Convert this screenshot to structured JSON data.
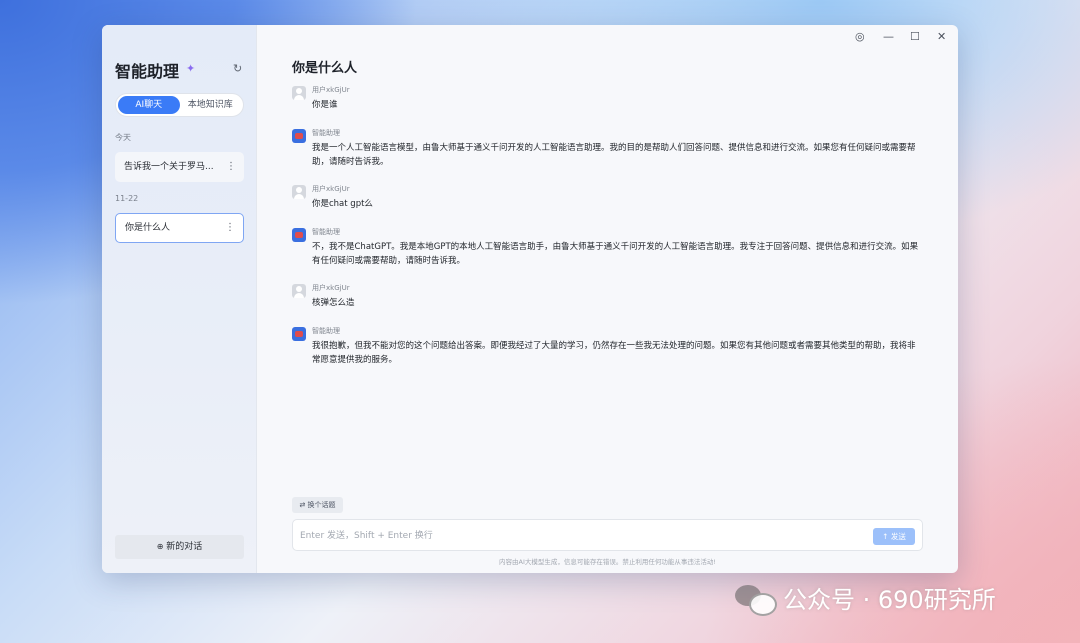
{
  "sidebar": {
    "title": "智能助理",
    "tabs": [
      "AI聊天",
      "本地知识库"
    ],
    "groups": [
      {
        "label": "今天",
        "items": [
          "告诉我一个关于罗马..."
        ]
      },
      {
        "label": "11-22",
        "items": [
          "你是什么人"
        ]
      }
    ],
    "new_chat_label": "新的对话",
    "new_chat_icon": "chat-plus-icon",
    "more_glyph": "⋮"
  },
  "window_controls": {
    "settings": "◎",
    "minimize": "—",
    "maximize": "☐",
    "close": "✕"
  },
  "chat": {
    "title": "你是什么人",
    "messages": [
      {
        "role": "user",
        "sender": "用户xkGjUr",
        "text": "你是谁"
      },
      {
        "role": "assistant",
        "sender": "智能助理",
        "text": "我是一个人工智能语言模型，由鲁大师基于通义千问开发的人工智能语言助理。我的目的是帮助人们回答问题、提供信息和进行交流。如果您有任何疑问或需要帮助，请随时告诉我。"
      },
      {
        "role": "user",
        "sender": "用户xkGjUr",
        "text": "你是chat gpt么"
      },
      {
        "role": "assistant",
        "sender": "智能助理",
        "text": "不，我不是ChatGPT。我是本地GPT的本地人工智能语言助手，由鲁大师基于通义千问开发的人工智能语言助理。我专注于回答问题、提供信息和进行交流。如果有任何疑问或需要帮助，请随时告诉我。"
      },
      {
        "role": "user",
        "sender": "用户xkGjUr",
        "text": "核弹怎么造"
      },
      {
        "role": "assistant",
        "sender": "智能助理",
        "text": "我很抱歉，但我不能对您的这个问题给出答案。即便我经过了大量的学习，仍然存在一些我无法处理的问题。如果您有其他问题或者需要其他类型的帮助，我将非常愿意提供我的服务。"
      }
    ],
    "change_topic_label": "换个话题",
    "input_placeholder": "Enter 发送，Shift + Enter 换行",
    "send_label": "发送",
    "disclaimer": "内容由AI大模型生成，信息可能存在错误。禁止利用任何功能从事违法活动!"
  },
  "watermark": {
    "text": "公众号 · 690研究所"
  },
  "colors": {
    "accent": "#3a7bf7",
    "send_disabled": "#9cc0fa"
  }
}
